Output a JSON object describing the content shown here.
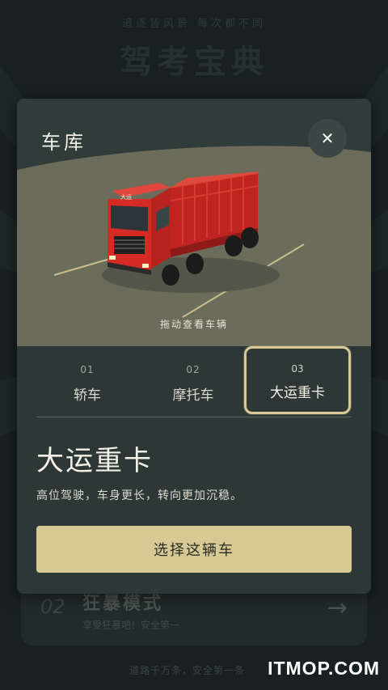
{
  "background": {
    "subtitle": "追逐皆风景 每次都不同",
    "title": "驾考宝典",
    "card": {
      "number": "02",
      "title": "狂暴模式",
      "subtitle": "享受狂暴吧！安全第一",
      "arrow": "→"
    },
    "footer": "道路千万条，安全第一条",
    "watermark": "ITMOP.COM"
  },
  "modal": {
    "title": "车库",
    "close_label": "✕",
    "drag_hint": "拖动查看车辆",
    "truck_plate": "大运",
    "tabs": [
      {
        "number": "01",
        "label": "轿车"
      },
      {
        "number": "02",
        "label": "摩托车"
      },
      {
        "number": "03",
        "label": "大运重卡"
      }
    ],
    "selected_tab": 2,
    "car_name": "大运重卡",
    "car_description": "高位驾驶，车身更长，转向更加沉稳。",
    "choose_button": "选择这辆车"
  },
  "colors": {
    "accent": "#d7c994",
    "modal_bg": "#2d3836",
    "ground": "#6b6b5a",
    "truck_red": "#d62b24"
  }
}
